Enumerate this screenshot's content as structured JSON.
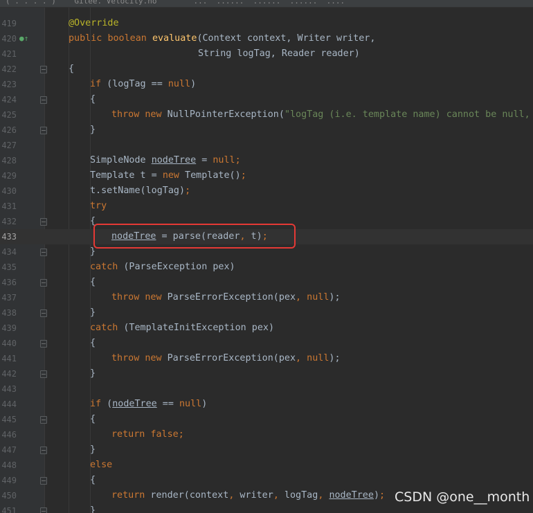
{
  "window": {
    "top_strip_text": "( . . . . )    Gitee. Velocity.no        ...  ......  ......  ......  ...."
  },
  "colors": {
    "background": "#2b2b2b",
    "gutter": "#313335",
    "keyword": "#cc7832",
    "function": "#ffc66d",
    "annotation": "#bbb529",
    "string": "#6a8759",
    "text": "#a9b7c6",
    "highlight_box": "#e53935"
  },
  "editor": {
    "current_line": "433",
    "lines": [
      {
        "no": "419",
        "text": "@Override"
      },
      {
        "no": "420",
        "text": "public boolean evaluate(Context context, Writer writer,",
        "gutter_icon": "override-icon"
      },
      {
        "no": "421",
        "text": "String logTag, Reader reader)"
      },
      {
        "no": "422",
        "text": "{"
      },
      {
        "no": "423",
        "text": "if (logTag == null)"
      },
      {
        "no": "424",
        "text": "{"
      },
      {
        "no": "425",
        "text": "throw new NullPointerException(\"logTag (i.e. template name) cannot be null, yo"
      },
      {
        "no": "426",
        "text": "}"
      },
      {
        "no": "427",
        "text": ""
      },
      {
        "no": "428",
        "text": "SimpleNode nodeTree = null;"
      },
      {
        "no": "429",
        "text": "Template t = new Template();"
      },
      {
        "no": "430",
        "text": "t.setName(logTag);"
      },
      {
        "no": "431",
        "text": "try"
      },
      {
        "no": "432",
        "text": "{"
      },
      {
        "no": "433",
        "text": "nodeTree = parse(reader, t);"
      },
      {
        "no": "434",
        "text": "}"
      },
      {
        "no": "435",
        "text": "catch (ParseException pex)"
      },
      {
        "no": "436",
        "text": "{"
      },
      {
        "no": "437",
        "text": "throw new ParseErrorException(pex, null);"
      },
      {
        "no": "438",
        "text": "}"
      },
      {
        "no": "439",
        "text": "catch (TemplateInitException pex)"
      },
      {
        "no": "440",
        "text": "{"
      },
      {
        "no": "441",
        "text": "throw new ParseErrorException(pex, null);"
      },
      {
        "no": "442",
        "text": "}"
      },
      {
        "no": "443",
        "text": ""
      },
      {
        "no": "444",
        "text": "if (nodeTree == null)"
      },
      {
        "no": "445",
        "text": "{"
      },
      {
        "no": "446",
        "text": "return false;"
      },
      {
        "no": "447",
        "text": "}"
      },
      {
        "no": "448",
        "text": "else"
      },
      {
        "no": "449",
        "text": "{"
      },
      {
        "no": "450",
        "text": "return render(context, writer, logTag, nodeTree);"
      },
      {
        "no": "451",
        "text": "}"
      }
    ]
  },
  "tokens": {
    "l419": {
      "ann": "@Override"
    },
    "l420": {
      "kw1": "public",
      "kw2": "boolean",
      "fn": "evaluate",
      "rest": "(Context context, Writer writer,"
    },
    "l421": {
      "text": "String logTag, Reader reader)"
    },
    "l423": {
      "kw": "if",
      "a": " (logTag == ",
      "nul": "null",
      ")": ")"
    },
    "l425": {
      "kw1": "throw",
      "kw2": "new",
      "cls": " NullPointerException(",
      "str": "\"logTag (i.e. template name) cannot be null, yo"
    },
    "l428": {
      "a": "SimpleNode ",
      "var": "nodeTree",
      "b": " = ",
      "nul": "null",
      ";": ";"
    },
    "l429": {
      "a": "Template t = ",
      "kw": "new",
      "b": " Template()",
      ";": ";"
    },
    "l430": {
      "a": "t.setName(logTag)",
      ";": ";"
    },
    "l431": {
      "kw": "try"
    },
    "l433": {
      "var": "nodeTree",
      "a": " = parse(reader",
      ",": ",",
      "b": " t)",
      ";": ";"
    },
    "l435": {
      "kw": "catch",
      "a": " (ParseException pex)"
    },
    "l437": {
      "kw1": "throw",
      "kw2": "new",
      "a": " ParseErrorException(pex",
      ",": ",",
      "nul": "null",
      "b": ");"
    },
    "l439": {
      "kw": "catch",
      "a": " (TemplateInitException pex)"
    },
    "l441": {
      "kw1": "throw",
      "kw2": "new",
      "a": " ParseErrorException(pex",
      ",": ",",
      "nul": "null",
      "b": ");"
    },
    "l444": {
      "kw": "if",
      "a": " (",
      "var": "nodeTree",
      "b": " == ",
      "nul": "null",
      "c": ")"
    },
    "l446": {
      "kw": "return",
      "f": "false",
      ";": ";"
    },
    "l448": {
      "kw": "else"
    },
    "l450": {
      "kw": "return",
      "a": " render(context",
      ",": ",",
      "b": " writer",
      ",2": ",",
      "c": " logTag",
      ",3": ",",
      "var": "nodeTree",
      "d": ")",
      ";": ";"
    }
  },
  "watermark": "CSDN @one__month"
}
